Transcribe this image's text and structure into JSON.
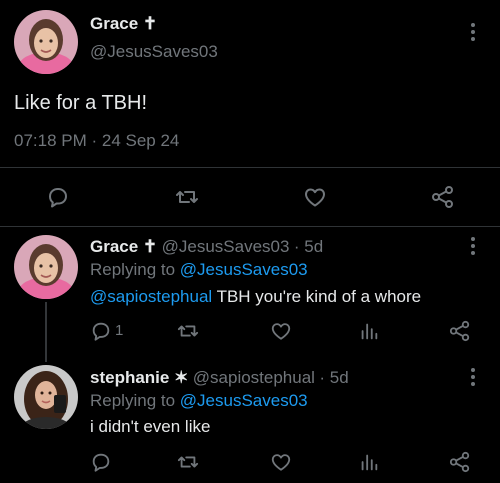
{
  "main_tweet": {
    "name": "Grace ✝",
    "handle": "@JesusSaves03",
    "text": "Like for a TBH!",
    "timestamp": "07:18 PM · 24 Sep 24"
  },
  "replies": [
    {
      "name": "Grace ✝",
      "handle": "@JesusSaves03",
      "age": "· 5d",
      "replying_prefix": "Replying to ",
      "replying_to": "@JesusSaves03",
      "mention": "@sapiostephual",
      "text": " TBH you're kind of a whore",
      "reply_count": "1"
    },
    {
      "name": "stephanie ✶",
      "handle": "@sapiostephual",
      "age": "· 5d",
      "replying_prefix": "Replying to ",
      "replying_to": "@JesusSaves03",
      "text": "i didn't even like",
      "reply_count": ""
    }
  ],
  "icons": [
    "reply-icon",
    "retweet-icon",
    "like-icon",
    "analytics-icon",
    "share-icon",
    "more-icon"
  ],
  "colors": {
    "background": "#000000",
    "text": "#e7e9ea",
    "muted": "#71767b",
    "link": "#1d9bf0",
    "divider": "#2f3336"
  }
}
